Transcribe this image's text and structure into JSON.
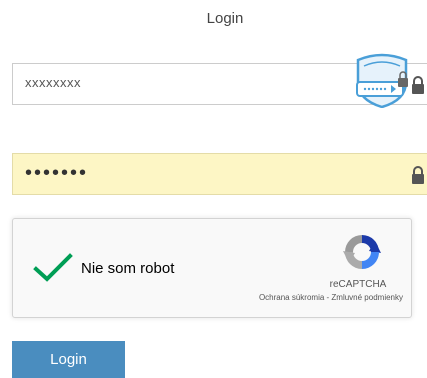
{
  "page": {
    "title": "Login"
  },
  "form": {
    "username": {
      "value": "xxxxxxxx",
      "icon": "lock-icon"
    },
    "password_manager": {
      "icon": "password-manager-shield-icon",
      "accent": "#4a9fd8"
    },
    "password": {
      "value": "•••••••",
      "icon": "lock-icon",
      "background": "#fdf6c5"
    },
    "captcha": {
      "label": "Nie som robot",
      "checked": true,
      "check_color": "#009e55",
      "brand": "reCAPTCHA",
      "links": "Ochrana súkromia - Zmluvné podmienky",
      "logo_icon": "recaptcha-logo-icon"
    },
    "submit": {
      "label": "Login",
      "color": "#4a8dbf"
    }
  }
}
